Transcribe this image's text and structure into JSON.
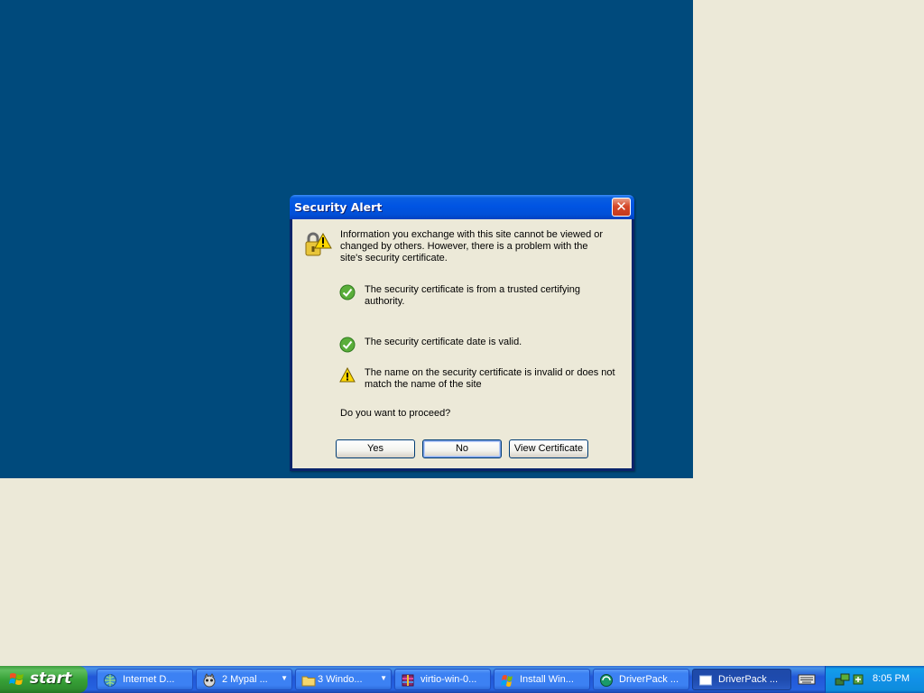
{
  "dialog": {
    "title": "Security Alert",
    "intro": "Information you exchange with this site cannot be viewed or changed by others. However, there is a problem with the site's security certificate.",
    "checks": [
      {
        "status": "ok",
        "text": "The security certificate is from a trusted certifying authority."
      },
      {
        "status": "ok",
        "text": "The security certificate date is valid."
      },
      {
        "status": "warning",
        "text": "The name on the security certificate is invalid or does not match the name of the site"
      }
    ],
    "question": "Do you want to proceed?",
    "buttons": {
      "yes": "Yes",
      "no": "No",
      "view_certificate": "View Certificate"
    },
    "close_glyph": "✕"
  },
  "taskbar": {
    "start_label": "start",
    "tasks": [
      {
        "label": "Internet D...",
        "icon": "globe-icon",
        "active": false
      },
      {
        "label": "2 Mypal ...",
        "icon": "mypal-icon",
        "active": false,
        "group": true
      },
      {
        "label": "3 Windo...",
        "icon": "folder-icon",
        "active": false,
        "group": true
      },
      {
        "label": "virtio-win-0...",
        "icon": "archive-icon",
        "active": false
      },
      {
        "label": "Install Win...",
        "icon": "installer-icon",
        "active": false
      },
      {
        "label": "DriverPack ...",
        "icon": "driverpack-icon",
        "active": false
      },
      {
        "label": "DriverPack ...",
        "icon": "window-icon",
        "active": true
      }
    ],
    "clock": "8:05 PM"
  },
  "colors": {
    "desktop_blue": "#004A7C",
    "desktop_beige": "#ECE9D8",
    "title_blue": "#0054E3",
    "start_green": "#38A238"
  }
}
